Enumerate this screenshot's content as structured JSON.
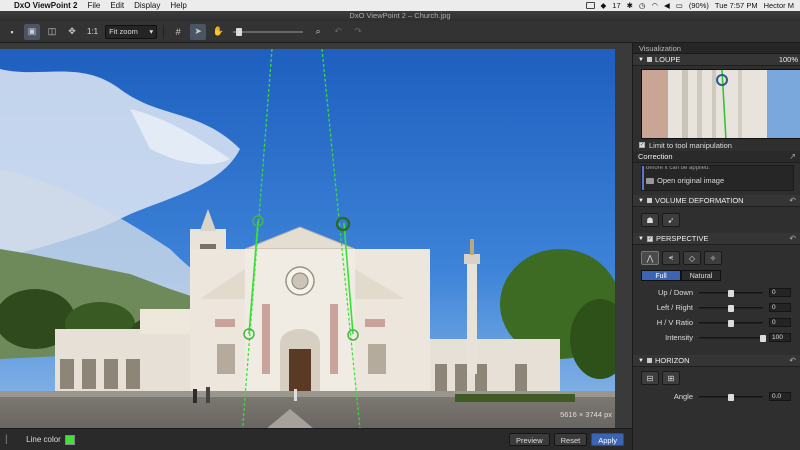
{
  "menubar": {
    "app_name": "DxO ViewPoint 2",
    "items": [
      "File",
      "Edit",
      "Display",
      "Help"
    ],
    "battery": "(90%)",
    "clock": "Tue 7:57 PM",
    "user": "Hector M",
    "badge_count": "17"
  },
  "window": {
    "title": "DxO ViewPoint 2 – Church.jpg"
  },
  "toolbar": {
    "one_to_one": "1:1",
    "zoom_value": "Fit zoom",
    "zoom_level": 0.05
  },
  "image": {
    "dimensions": "5616 × 3744 px"
  },
  "bottombar": {
    "line_color_label": "Line color",
    "line_color": "#3fe23a",
    "preview_label": "Preview",
    "reset_label": "Reset",
    "apply_label": "Apply"
  },
  "panel": {
    "title": "Visualization",
    "loupe": {
      "header": "LOUPE",
      "zoom": "100%"
    },
    "limit_label": "Limit to tool manipulation",
    "correction": {
      "header": "Correction",
      "cut_text": "before it can be applied.",
      "open_original": "Open original image"
    },
    "volume": {
      "header": "VOLUME DEFORMATION"
    },
    "perspective": {
      "header": "PERSPECTIVE",
      "mode_full": "Full",
      "mode_natural": "Natural",
      "sliders": [
        {
          "label": "Up / Down",
          "value": "0",
          "position": 0.5
        },
        {
          "label": "Left / Right",
          "value": "0",
          "position": 0.5
        },
        {
          "label": "H / V Ratio",
          "value": "0",
          "position": 0.5
        },
        {
          "label": "Intensity",
          "value": "100",
          "position": 1.0
        }
      ]
    },
    "horizon": {
      "header": "HORIZON",
      "angle_label": "Angle",
      "angle_value": "0.0",
      "angle_position": 0.5
    }
  }
}
